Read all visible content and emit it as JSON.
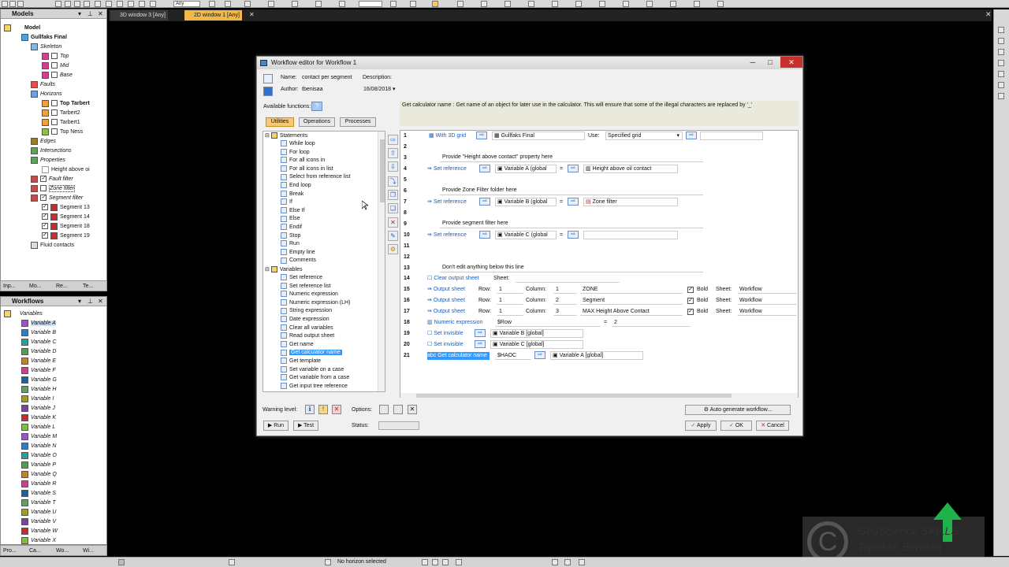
{
  "toolbar": {
    "combo1": "Any"
  },
  "models_panel": {
    "title": "Models",
    "root": "Model",
    "project": "Gullfaks Final",
    "items": [
      {
        "label": "Skeleton"
      },
      {
        "label": "Top"
      },
      {
        "label": "Mid"
      },
      {
        "label": "Base"
      },
      {
        "label": "Faults"
      },
      {
        "label": "Horizons"
      },
      {
        "label": "Top Tarbert"
      },
      {
        "label": "Tarbert2"
      },
      {
        "label": "Tarbert1"
      },
      {
        "label": "Top Ness"
      },
      {
        "label": "Edges"
      },
      {
        "label": "Intersections"
      },
      {
        "label": "Properties"
      },
      {
        "label": "Height above oi"
      },
      {
        "label": "Fault filter"
      },
      {
        "label": "Zone filter"
      },
      {
        "label": "Segment filter"
      },
      {
        "label": "Segment 13"
      },
      {
        "label": "Segment 14"
      },
      {
        "label": "Segment 18"
      },
      {
        "label": "Segment 19"
      },
      {
        "label": "Fluid contacts"
      }
    ],
    "tabs": [
      "Inp...",
      "Mo...",
      "Re...",
      "Te..."
    ]
  },
  "workflows_panel": {
    "title": "Workflows",
    "folder": "Variables",
    "variables": [
      "Variable A",
      "Variable B",
      "Variable C",
      "Variable D",
      "Variable E",
      "Variable F",
      "Variable G",
      "Variable H",
      "Variable I",
      "Variable J",
      "Variable K",
      "Variable L",
      "Variable M",
      "Variable N",
      "Variable O",
      "Variable P",
      "Variable Q",
      "Variable R",
      "Variable S",
      "Variable T",
      "Variable U",
      "Variable V",
      "Variable W",
      "Variable X"
    ],
    "tabs": [
      "Pro...",
      "Ca...",
      "Wo...",
      "Wi..."
    ]
  },
  "viewport_tabs": [
    {
      "label": "3D window 3 [Any]"
    },
    {
      "label": "2D window 1 [Any]"
    }
  ],
  "dialog": {
    "title": "Workflow editor for Workflow 1",
    "name_label": "Name:",
    "name_value": "contact per segment",
    "description_label": "Description:",
    "author_label": "Author:",
    "author_value": "tbenisaa",
    "date_value": "16/08/2018",
    "available_functions": "Available functions:",
    "tabs": [
      "Utilities",
      "Operations",
      "Processes"
    ],
    "help_text": "Get calculator name : Get name of an object for later use in the calculator. This will ensure that some of the illegal characters are replaced by '_'",
    "statements_header": "Statements",
    "statements": [
      "While loop",
      "For loop",
      "For all icons in",
      "For all icons in list",
      "Select from reference list",
      "End loop",
      "Break",
      "If",
      "Else If",
      "Else",
      "Endif",
      "Stop",
      "Run",
      "Empty line",
      "Comments"
    ],
    "variables_header": "Variables",
    "variables_fns": [
      "Set reference",
      "Set reference list",
      "Numeric expression",
      "Numeric expression (LH)",
      "String expression",
      "Date expression",
      "Clear all variables",
      "Read output sheet",
      "Get name",
      "Get calculator name",
      "Get template",
      "Set variable on a case",
      "Get variable from a case",
      "Get input tree reference"
    ],
    "warning_label": "Warning level:",
    "options_label": "Options:",
    "status_label": "Status:",
    "run": "Run",
    "test": "Test",
    "auto_generate": "Auto generate workflow...",
    "apply": "Apply",
    "ok": "OK",
    "cancel": "Cancel"
  },
  "workflow": {
    "line_numbers": [
      "1",
      "2",
      "3",
      "4",
      "5",
      "6",
      "7",
      "8",
      "9",
      "10",
      "11",
      "12",
      "13",
      "14",
      "15",
      "16",
      "17",
      "18",
      "19",
      "20",
      "21"
    ],
    "l1": {
      "kw": "With 3D grid",
      "grid": "Gullfaks Final",
      "use_label": "Use:",
      "use_value": "Specified grid"
    },
    "l3": "Provide \"Height above contact\" property here",
    "l4": {
      "kw": "Set reference",
      "var": "Variable A (global",
      "eq": "=",
      "target": "Height above oil contact"
    },
    "l6": "Provide Zone Filter folder here",
    "l7": {
      "kw": "Set reference",
      "var": "Variable B (global",
      "eq": "=",
      "target": "Zone filter"
    },
    "l9": "Provide segment filter here",
    "l10": {
      "kw": "Set reference",
      "var": "Variable C (global",
      "eq": "="
    },
    "l13": "Don't edit anything below this line",
    "l14": {
      "kw": "Clear output sheet",
      "sheet_label": "Sheet:"
    },
    "out_rows": [
      {
        "kw": "Output sheet",
        "row_label": "Row:",
        "row": "1",
        "col_label": "Column:",
        "col": "1",
        "value": "ZONE",
        "bold": "Bold",
        "sheet_label": "Sheet:",
        "sheet": "Workflow"
      },
      {
        "kw": "Output sheet",
        "row_label": "Row:",
        "row": "1",
        "col_label": "Column:",
        "col": "2",
        "value": "Segment",
        "bold": "Bold",
        "sheet_label": "Sheet:",
        "sheet": "Workflow"
      },
      {
        "kw": "Output sheet",
        "row_label": "Row:",
        "row": "1",
        "col_label": "Column:",
        "col": "3",
        "value": "MAX Height Above Contact",
        "bold": "Bold",
        "sheet_label": "Sheet:",
        "sheet": "Workflow"
      }
    ],
    "l18": {
      "kw": "Numeric expression",
      "var": "$Row",
      "eq": "=",
      "value": "2"
    },
    "l19": {
      "kw": "Set invisible",
      "var": "Variable B [global]"
    },
    "l20": {
      "kw": "Set invisible",
      "var": "Variable C [global]"
    },
    "l21": {
      "kw": "Get calculator name",
      "var": "$HAOC",
      "target": "Variable A [global]"
    }
  },
  "statusbar": {
    "text": "No horizon selected"
  },
  "watermark": {
    "line1": "GeoScience SKILLS",
    "line2": "Tajeddin Benissa"
  }
}
